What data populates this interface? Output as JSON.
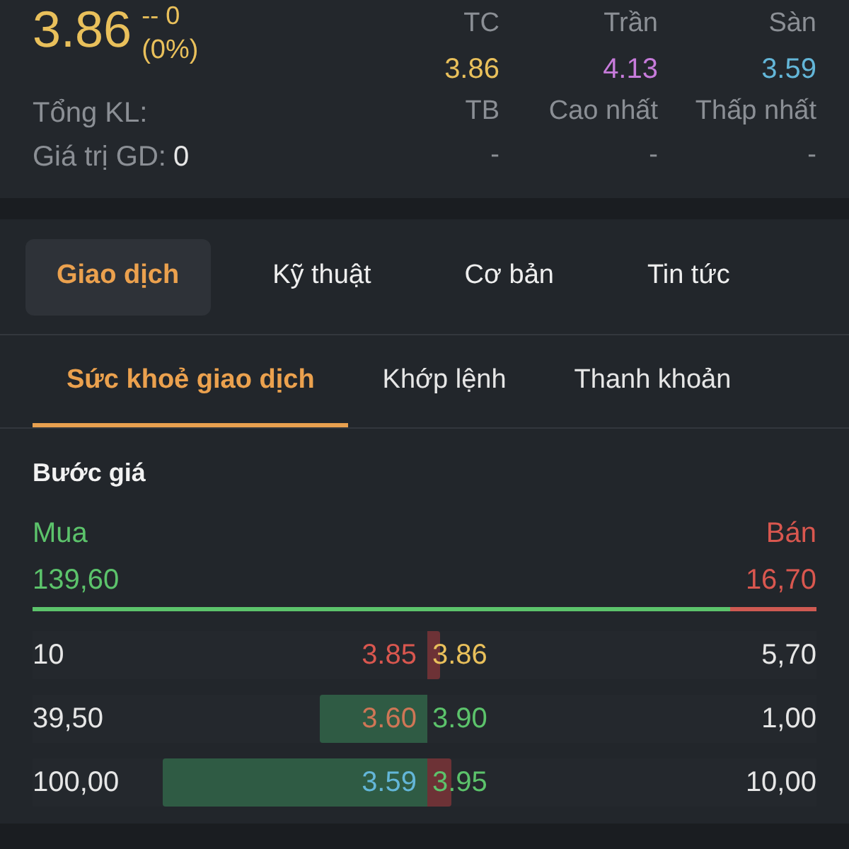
{
  "quote": {
    "price": "3.86",
    "change": "-- 0",
    "change_percent": "(0%)",
    "color": "#e9c05b"
  },
  "stats": {
    "total_volume_label": "Tổng KL:",
    "value_label": "Giá trị GD:",
    "value": "0"
  },
  "price_levels": [
    {
      "label": "TC",
      "value": "3.86",
      "color": "#e9c05b"
    },
    {
      "label": "Trần",
      "value": "4.13",
      "color": "#c77bdb"
    },
    {
      "label": "Sàn",
      "value": "3.59",
      "color": "#63b6d8"
    }
  ],
  "summary": [
    {
      "label": "TB",
      "value": "-"
    },
    {
      "label": "Cao nhất",
      "value": "-"
    },
    {
      "label": "Thấp nhất",
      "value": "-"
    }
  ],
  "tabs": [
    {
      "label": "Giao dịch",
      "selected": true
    },
    {
      "label": "Kỹ thuật",
      "selected": false
    },
    {
      "label": "Cơ bản",
      "selected": false
    },
    {
      "label": "Tin tức",
      "selected": false
    }
  ],
  "subtabs": [
    {
      "label": "Sức khoẻ giao dịch",
      "selected": true
    },
    {
      "label": "Khớp lệnh",
      "selected": false
    },
    {
      "label": "Thanh khoản",
      "selected": false
    }
  ],
  "order_book": {
    "title": "Bước giá",
    "buy_label": "Mua",
    "sell_label": "Bán",
    "buy_total": "139,60",
    "sell_total": "16,70",
    "buy_share": {
      "level": 0.89
    },
    "rows": [
      {
        "bid": {
          "volume": "10",
          "price": "3.85",
          "color": "#d9574f"
        },
        "ask": {
          "price": "3.86",
          "color": "#e9c05b",
          "depth": {
            "level": 0.035
          },
          "volume": "5,70"
        }
      },
      {
        "bid": {
          "volume": "39,50",
          "price": "3.60",
          "color": "#cf7656",
          "depth": {
            "level": 0.27
          }
        },
        "ask": {
          "price": "3.90",
          "color": "#5cc36b",
          "volume": "1,00"
        }
      },
      {
        "bid": {
          "volume": "100,00",
          "price": "3.59",
          "color": "#63b6d8",
          "depth": {
            "level": 0.67
          }
        },
        "ask": {
          "price": "3.95",
          "color": "#5cc36b",
          "depth": {
            "level": 0.062
          },
          "volume": "10,00"
        }
      }
    ]
  }
}
